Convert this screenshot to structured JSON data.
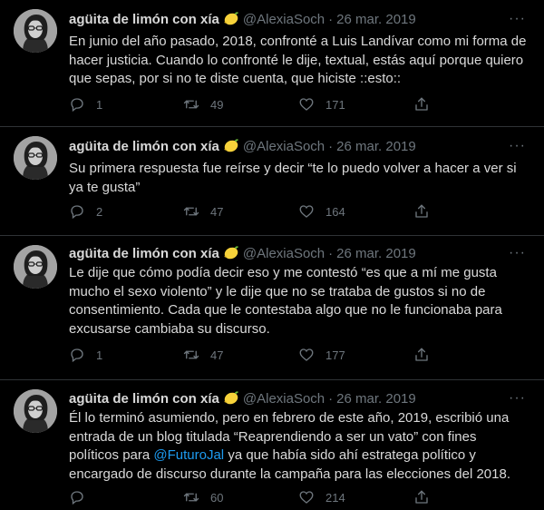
{
  "tweets": [
    {
      "name": "agüita de limón con xía",
      "handle": "@AlexiaSoch",
      "date": "26 mar. 2019",
      "text": "En junio del año pasado, 2018, confronté a Luis Landívar como mi forma de hacer justicia. Cuando lo confronté le dije, textual, estás aquí porque quiero que sepas, por si no te diste cuenta, que hiciste ::esto::",
      "replies": "1",
      "retweets": "49",
      "likes": "171"
    },
    {
      "name": "agüita de limón con xía",
      "handle": "@AlexiaSoch",
      "date": "26 mar. 2019",
      "text": "Su primera respuesta fue reírse y decir “te lo puedo volver a hacer a ver si ya te gusta”",
      "replies": "2",
      "retweets": "47",
      "likes": "164"
    },
    {
      "name": "agüita de limón con xía",
      "handle": "@AlexiaSoch",
      "date": "26 mar. 2019",
      "text": "Le dije que cómo podía decir eso y me contestó “es que a mí me gusta mucho el sexo violento” y le dije que no se trataba de gustos si no de consentimiento. Cada que le contestaba algo que no le funcionaba para excusarse cambiaba su discurso.",
      "replies": "1",
      "retweets": "47",
      "likes": "177"
    },
    {
      "name": "agüita de limón con xía",
      "handle": "@AlexiaSoch",
      "date": "26 mar. 2019",
      "text_before": "Él lo terminó asumiendo, pero en febrero de este año, 2019, escribió una entrada de un blog titulada “Reaprendiendo a ser un vato” con fines políticos para ",
      "mention": "@FuturoJal",
      "text_after": " ya que había sido ahí estratega político y encargado de discurso durante la campaña para las elecciones del 2018.",
      "replies": "",
      "retweets": "60",
      "likes": "214"
    }
  ],
  "icons": {
    "reply": "reply-icon",
    "retweet": "retweet-icon",
    "like": "heart-icon",
    "share": "share-icon",
    "more": "more-icon",
    "emoji": "lemon-emoji"
  },
  "colors": {
    "background": "#000000",
    "text": "#d9d9d9",
    "muted": "#6e767d",
    "link": "#1d9bf0"
  }
}
